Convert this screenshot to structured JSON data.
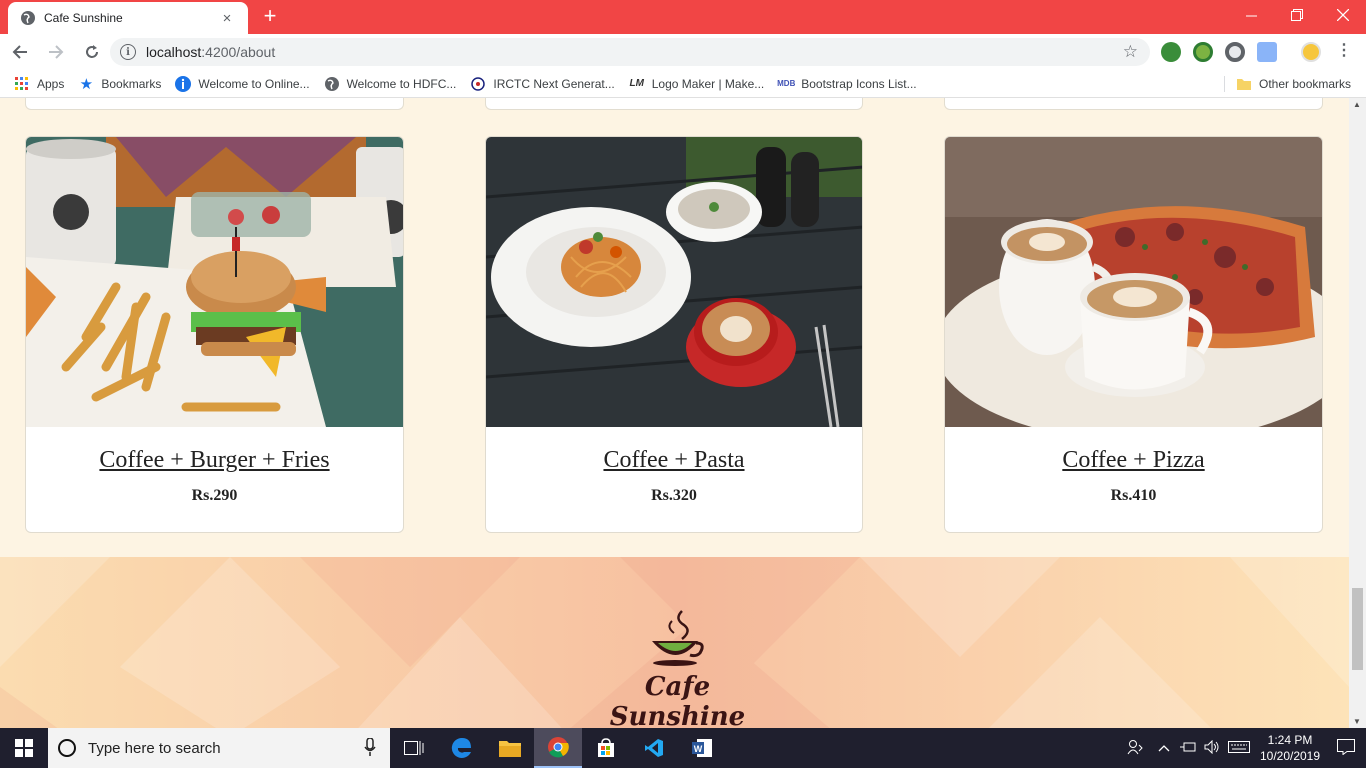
{
  "browser": {
    "tab_title": "Cafe Sunshine",
    "tab_close": "×",
    "new_tab": "+",
    "url_host": "localhost",
    "url_path": ":4200/about",
    "info_icon_glyph": "i",
    "star_glyph": "☆"
  },
  "bookmarks": [
    {
      "label": "Apps",
      "icon": "apps-grid-icon"
    },
    {
      "label": "Bookmarks",
      "icon": "star-icon"
    },
    {
      "label": "Welcome to Online...",
      "icon": "info-circle-icon"
    },
    {
      "label": "Welcome to HDFC...",
      "icon": "globe-icon"
    },
    {
      "label": "IRCTC Next Generat...",
      "icon": "irctc-icon"
    },
    {
      "label": "Logo Maker | Make...",
      "icon": "lm-icon"
    },
    {
      "label": "Bootstrap Icons List...",
      "icon": "mdb-icon"
    }
  ],
  "other_bookmarks": "Other bookmarks",
  "menu": [
    {
      "name": "Coffee + Burger + Fries",
      "price": "Rs.290"
    },
    {
      "name": "Coffee + Pasta",
      "price": "Rs.320"
    },
    {
      "name": "Coffee + Pizza",
      "price": "Rs.410"
    }
  ],
  "footer": {
    "brand": "Cafe Sunshine"
  },
  "taskbar": {
    "search_placeholder": "Type here to search",
    "time": "1:24 PM",
    "date": "10/20/2019"
  },
  "colors": {
    "titlebar": "#f14545",
    "page_bg": "#fdf4e3",
    "brand_text": "#3a1414",
    "taskbar": "#1f1f2e"
  }
}
